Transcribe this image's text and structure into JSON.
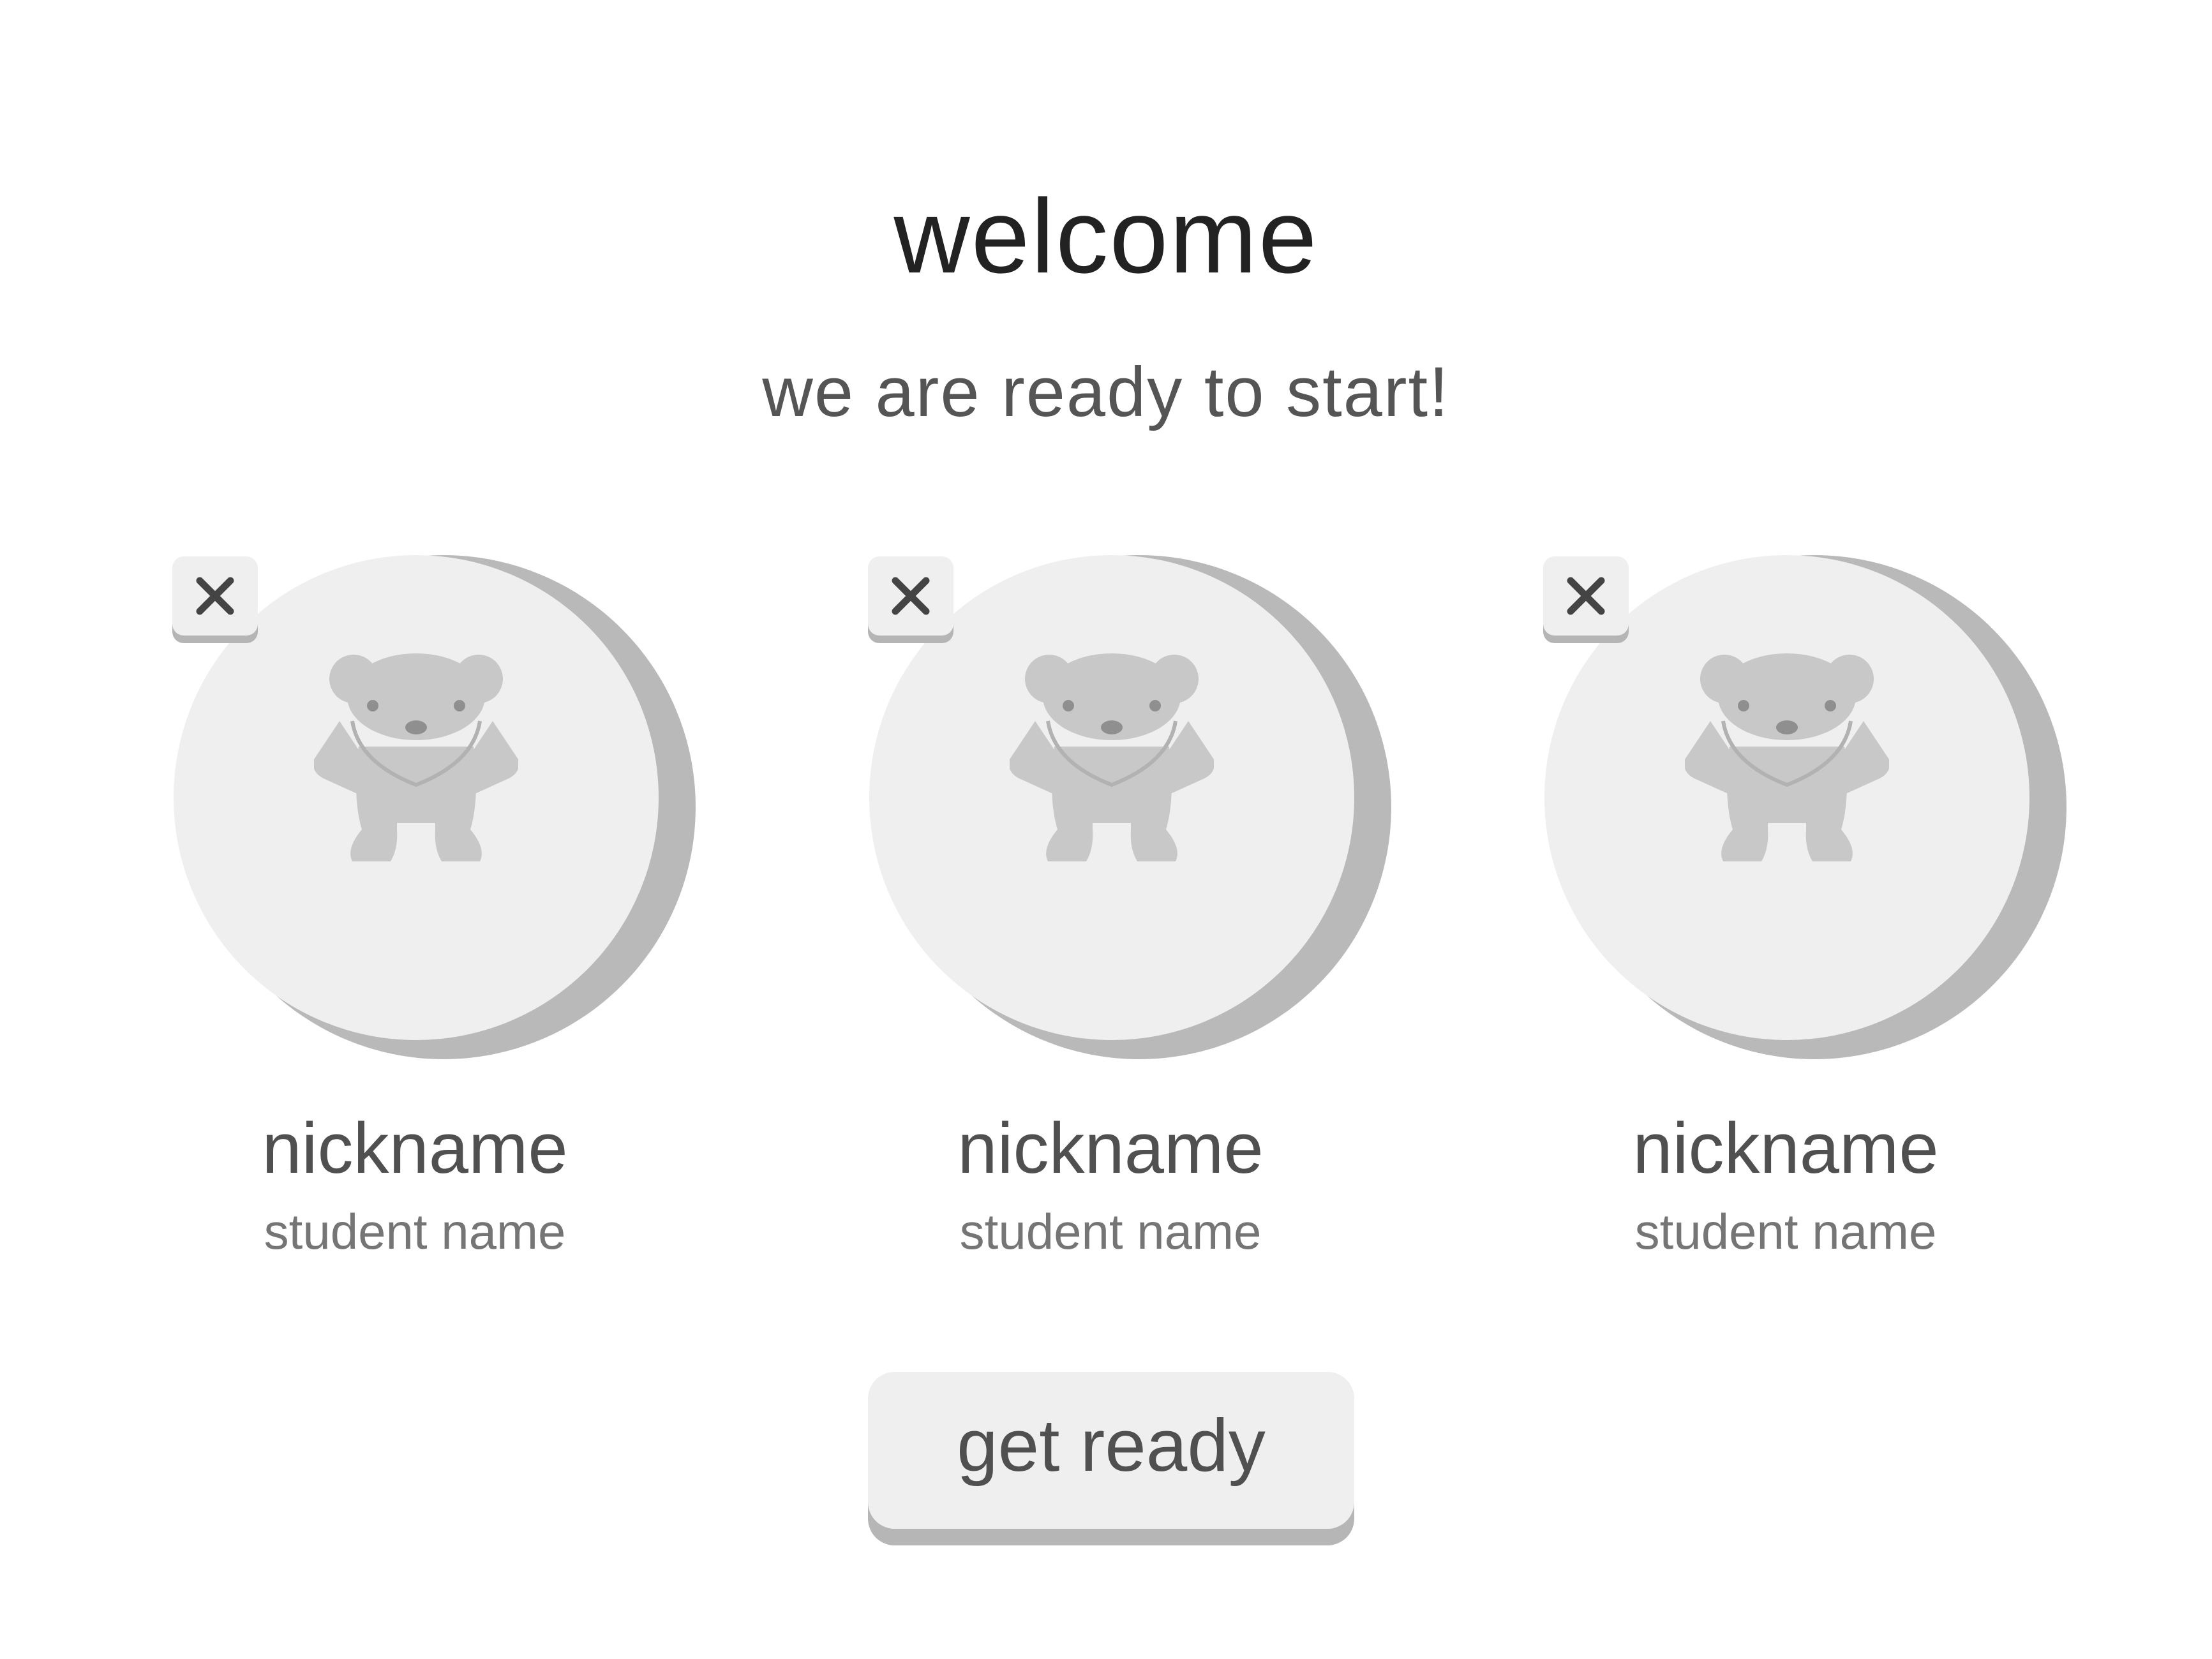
{
  "header": {
    "title": "welcome",
    "subtitle": "we are ready to start!"
  },
  "players": [
    {
      "nickname": "nickname",
      "student_name": "student name",
      "avatar_icon": "teddy-bear-icon",
      "remove_icon": "close-icon"
    },
    {
      "nickname": "nickname",
      "student_name": "student name",
      "avatar_icon": "teddy-bear-icon",
      "remove_icon": "close-icon"
    },
    {
      "nickname": "nickname",
      "student_name": "student name",
      "avatar_icon": "teddy-bear-icon",
      "remove_icon": "close-icon"
    }
  ],
  "actions": {
    "get_ready_label": "get ready"
  },
  "colors": {
    "background": "#ffffff",
    "card_face": "#efefef",
    "card_shadow": "#b9b9b9",
    "bear": "#c8c8c8",
    "title_text": "#222222",
    "body_text": "#505050"
  }
}
